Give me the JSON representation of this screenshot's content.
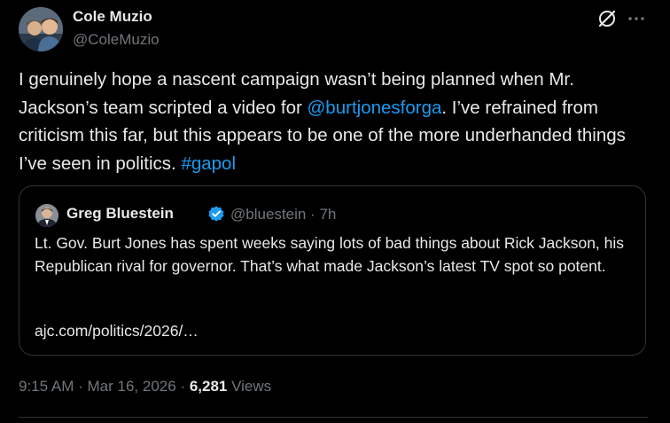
{
  "author": {
    "display_name": "Cole Muzio",
    "handle": "@ColeMuzio",
    "avatar_icon": "profile-photo"
  },
  "actions": {
    "grok_icon": "grok-icon",
    "more_icon": "more-icon"
  },
  "tweet": {
    "segments": [
      {
        "text": "I genuinely hope a nascent campaign wasn’t being planned when Mr. Jackson’s team scripted a video for ",
        "type": "text"
      },
      {
        "text": "@burtjonesforga",
        "type": "mention"
      },
      {
        "text": ". I’ve refrained from criticism this far, but this appears to be one of the more underhanded things I’ve seen in politics. ",
        "type": "text"
      },
      {
        "text": "#gapol",
        "type": "hashtag"
      }
    ]
  },
  "quoted_tweet": {
    "display_name": "Greg Bluestein",
    "handle": "@bluestein",
    "separator": "·",
    "time_ago": "7h",
    "verified": true,
    "text": "Lt. Gov. Burt Jones has spent weeks saying lots of bad things about Rick Jackson, his Republican rival for governor. That’s what made Jackson’s latest TV spot so potent.",
    "link_text": "ajc.com/politics/2026/…"
  },
  "meta": {
    "time": "9:15 AM",
    "separator": "·",
    "date": "Mar 16, 2026",
    "views_count": "6,281",
    "views_label": "Views"
  },
  "colors": {
    "background": "#000000",
    "text": "#e7e9ea",
    "muted": "#71767b",
    "link": "#1d9bf0",
    "border": "#2f3336"
  }
}
